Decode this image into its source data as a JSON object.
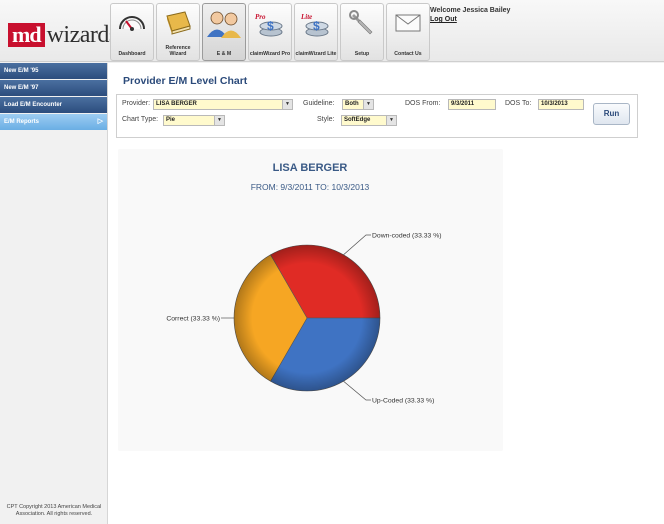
{
  "logo": {
    "part1": "md",
    "part2": "wizards"
  },
  "toolbar": {
    "items": [
      {
        "label": "Dashboard",
        "icon": "speedometer-icon"
      },
      {
        "label": "Reference Wizard",
        "icon": "book-icon"
      },
      {
        "label": "E & M",
        "icon": "users-icon"
      },
      {
        "label": "claimWizard Pro",
        "icon": "claimwizard-pro-icon"
      },
      {
        "label": "claimWizard Lite",
        "icon": "claimwizard-lite-icon"
      },
      {
        "label": "Setup",
        "icon": "wrench-icon"
      },
      {
        "label": "Contact Us",
        "icon": "envelope-icon"
      }
    ]
  },
  "user": {
    "welcome": "Welcome Jessica Bailey",
    "logout": "Log Out"
  },
  "sidebar": {
    "items": [
      {
        "label": "New E/M '95"
      },
      {
        "label": "New E/M '97"
      },
      {
        "label": "Load E/M Encounter"
      },
      {
        "label": "E/M Reports"
      }
    ],
    "arrow": "▷",
    "copyright": "CPT Copyright 2013 American Medical Association. All rights reserved."
  },
  "page": {
    "title": "Provider E/M Level Chart"
  },
  "filters": {
    "provider_label": "Provider:",
    "provider_value": "LISA BERGER",
    "guideline_label": "Guideline:",
    "guideline_value": "Both",
    "dos_from_label": "DOS From:",
    "dos_from_value": "9/3/2011",
    "dos_to_label": "DOS To:",
    "dos_to_value": "10/3/2013",
    "chart_type_label": "Chart Type:",
    "chart_type_value": "Pie",
    "style_label": "Style:",
    "style_value": "SoftEdge",
    "run_label": "Run"
  },
  "colors": {
    "header_blue": "#2b4a7a",
    "logo_red": "#c8102e",
    "field_bg": "#fffacd"
  },
  "chart_data": {
    "type": "pie",
    "title": "LISA BERGER",
    "subtitle": "FROM: 9/3/2011   TO: 10/3/2013",
    "slices": [
      {
        "label": "Down-coded (33.33 %)",
        "value": 33.33,
        "color": "#e02b25"
      },
      {
        "label": "Up-Coded (33.33 %)",
        "value": 33.33,
        "color": "#3f73c3"
      },
      {
        "label": "Correct (33.33 %)",
        "value": 33.33,
        "color": "#f6a623"
      }
    ]
  }
}
